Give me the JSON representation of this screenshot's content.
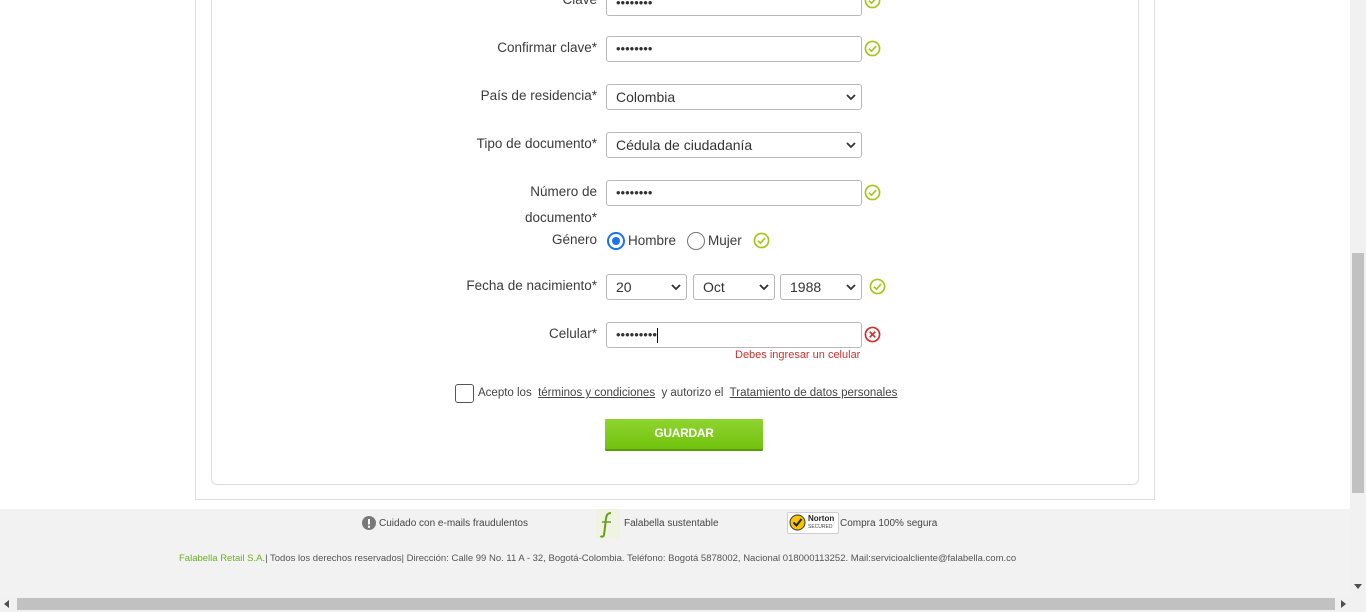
{
  "form": {
    "password_label": "Clave",
    "password_value": "••••••••",
    "confirm_label": "Confirmar clave*",
    "confirm_value": "••••••••",
    "country_label": "País de residencia*",
    "country_value": "Colombia",
    "doctype_label": "Tipo de documento*",
    "doctype_value": "Cédula de ciudadanía",
    "docnum_label_1": "Número de",
    "docnum_label_2": "documento*",
    "docnum_value": "••••••••",
    "gender_label": "Género",
    "gender_male": "Hombre",
    "gender_female": "Mujer",
    "birth_label": "Fecha de nacimiento*",
    "birth_day": "20",
    "birth_month": "Oct",
    "birth_year": "1988",
    "phone_label": "Celular*",
    "phone_value": "•••••••••",
    "phone_error": "Debes ingresar un celular",
    "terms_prefix": "Acepto los",
    "terms_link": "términos y condiciones",
    "terms_middle": "y autorizo el",
    "privacy_link": "Tratamiento de datos personales",
    "save_label": "GUARDAR"
  },
  "footer": {
    "fraud_text": "Cuidado con e-mails fraudulentos",
    "sustainable_text": "Falabella sustentable",
    "norton_badge": "Norton",
    "norton_sub": "SECURED",
    "secure_text": "Compra 100% segura",
    "legal_brand": "Falabella Retail S.A.",
    "legal_text": "| Todos los derechos reservados| Dirección: Calle 99 No. 11 A - 32, Bogotá-Colombia. Teléfono: Bogotá 5878002, Nacional 018000113252. Mail:servicioalcliente@falabella.com.co"
  },
  "colors": {
    "ok": "#a5c71b",
    "error": "#d0312d",
    "button": "#7dc91a",
    "link_brand": "#6ab023"
  },
  "icons": {
    "ok": "check-circle-icon",
    "error": "x-circle-icon",
    "chevron": "chevron-down-icon",
    "fraud": "exclamation-circle-icon",
    "sustainable": "falabella-f-logo",
    "norton": "norton-secured-badge"
  }
}
